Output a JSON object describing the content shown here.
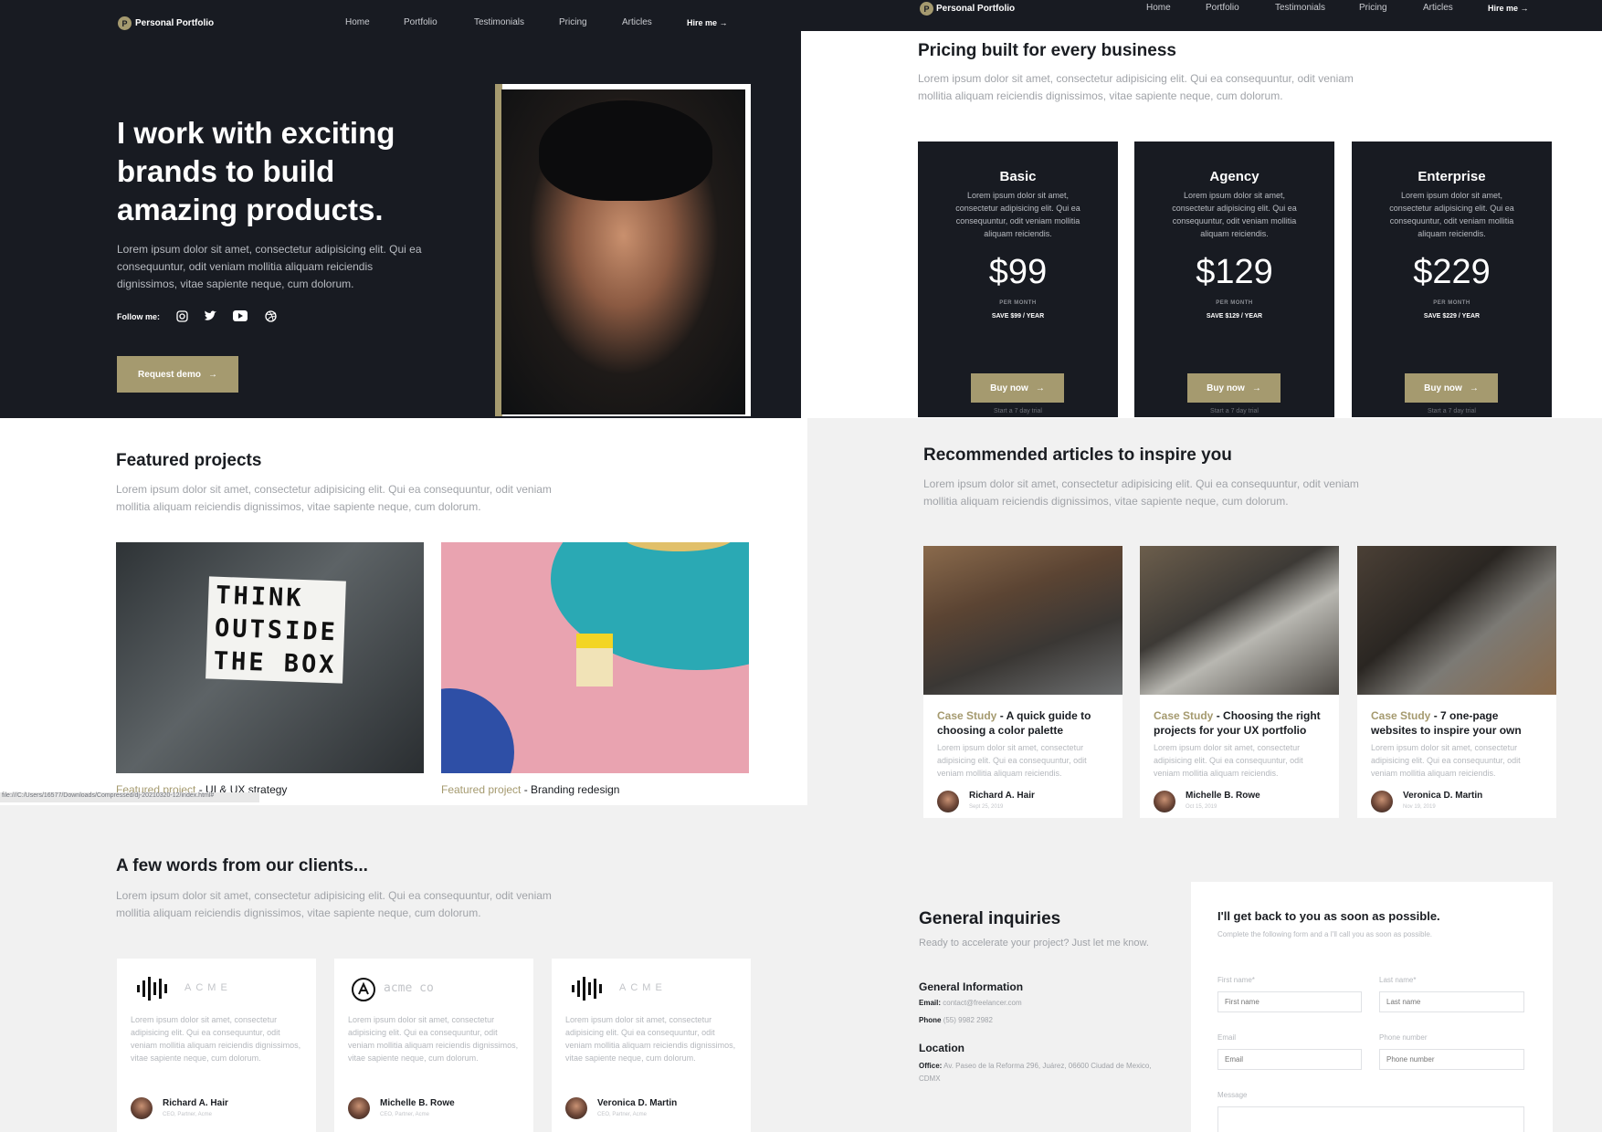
{
  "nav": {
    "logo_letter": "P",
    "brand": "Personal Portfolio",
    "links": [
      "Home",
      "Portfolio",
      "Testimonials",
      "Pricing",
      "Articles"
    ],
    "hire": "Hire me"
  },
  "hero": {
    "title": "I work with exciting brands to build amazing products.",
    "body": "Lorem ipsum dolor sit amet, consectetur adipisicing elit. Qui ea consequuntur, odit veniam mollitia aliquam reiciendis dignissimos, vitae sapiente neque, cum dolorum.",
    "follow_label": "Follow me:",
    "social": [
      "instagram-icon",
      "twitter-icon",
      "youtube-icon",
      "dribbble-icon"
    ],
    "cta": "Request demo"
  },
  "pricing": {
    "title": "Pricing built for every business",
    "subtitle": "Lorem ipsum dolor sit amet, consectetur adipisicing elit. Qui ea consequuntur, odit veniam mollitia aliquam reiciendis dignissimos, vitae sapiente neque, cum dolorum.",
    "plans": [
      {
        "name": "Basic",
        "desc": "Lorem ipsum dolor sit amet, consectetur adipisicing elit. Qui ea consequuntur, odit veniam mollitia aliquam reiciendis.",
        "price": "$99",
        "per": "PER MONTH",
        "save": "SAVE $99 / YEAR",
        "button": "Buy now",
        "trial": "Start a 7 day trial"
      },
      {
        "name": "Agency",
        "desc": "Lorem ipsum dolor sit amet, consectetur adipisicing elit. Qui ea consequuntur, odit veniam mollitia aliquam reiciendis.",
        "price": "$129",
        "per": "PER MONTH",
        "save": "SAVE $129 / YEAR",
        "button": "Buy now",
        "trial": "Start a 7 day trial"
      },
      {
        "name": "Enterprise",
        "desc": "Lorem ipsum dolor sit amet, consectetur adipisicing elit. Qui ea consequuntur, odit veniam mollitia aliquam reiciendis.",
        "price": "$229",
        "per": "PER MONTH",
        "save": "SAVE $229 / YEAR",
        "button": "Buy now",
        "trial": "Start a 7 day trial"
      }
    ]
  },
  "featured": {
    "title": "Featured projects",
    "subtitle": "Lorem ipsum dolor sit amet, consectetur adipisicing elit. Qui ea consequuntur, odit veniam mollitia aliquam reiciendis dignissimos, vitae sapiente neque, cum dolorum.",
    "lightbox_text": [
      "THINK",
      "OUTSIDE",
      "THE BOX"
    ],
    "projects": [
      {
        "tag": "Featured project",
        "name": " - UI & UX strategy"
      },
      {
        "tag": "Featured project",
        "name": " - Branding redesign"
      }
    ],
    "status_url": "file:///C:/Users/16577/Downloads/Compressed/dj-20210320-12/index.html#"
  },
  "articles": {
    "title": "Recommended articles to inspire you",
    "subtitle": "Lorem ipsum dolor sit amet, consectetur adipisicing elit. Qui ea consequuntur, odit veniam mollitia aliquam reiciendis dignissimos, vitae sapiente neque, cum dolorum.",
    "items": [
      {
        "tag": "Case Study",
        "title": " - A quick guide to choosing a color palette",
        "desc": "Lorem ipsum dolor sit amet, consectetur adipisicing elit. Qui ea consequuntur, odit veniam mollitia aliquam reiciendis.",
        "author": "Richard A. Hair",
        "date": "Sept 25, 2019"
      },
      {
        "tag": "Case Study",
        "title": " - Choosing the right projects for your UX portfolio",
        "desc": "Lorem ipsum dolor sit amet, consectetur adipisicing elit. Qui ea consequuntur, odit veniam mollitia aliquam reiciendis.",
        "author": "Michelle B. Rowe",
        "date": "Oct 15, 2019"
      },
      {
        "tag": "Case Study",
        "title": " - 7 one-page websites to inspire your own",
        "desc": "Lorem ipsum dolor sit amet, consectetur adipisicing elit. Qui ea consequuntur, odit veniam mollitia aliquam reiciendis.",
        "author": "Veronica D. Martin",
        "date": "Nov 19, 2019"
      }
    ]
  },
  "clients": {
    "title": "A few words from our clients...",
    "subtitle": "Lorem ipsum dolor sit amet, consectetur adipisicing elit. Qui ea consequuntur, odit veniam mollitia aliquam reiciendis dignissimos, vitae sapiente neque, cum dolorum.",
    "items": [
      {
        "logo": "ACME",
        "desc": "Lorem ipsum dolor sit amet, consectetur adipisicing elit. Qui ea consequuntur, odit veniam mollitia aliquam reiciendis dignissimos, vitae sapiente neque, cum dolorum.",
        "name": "Richard A. Hair",
        "role": "CEO, Partner, Acme"
      },
      {
        "logo": "acme co",
        "desc": "Lorem ipsum dolor sit amet, consectetur adipisicing elit. Qui ea consequuntur, odit veniam mollitia aliquam reiciendis dignissimos, vitae sapiente neque, cum dolorum.",
        "name": "Michelle B. Rowe",
        "role": "CEO, Partner, Acme"
      },
      {
        "logo": "ACME",
        "desc": "Lorem ipsum dolor sit amet, consectetur adipisicing elit. Qui ea consequuntur, odit veniam mollitia aliquam reiciendis dignissimos, vitae sapiente neque, cum dolorum.",
        "name": "Veronica D. Martin",
        "role": "CEO, Partner, Acme"
      }
    ]
  },
  "inquiries": {
    "title": "General inquiries",
    "subtitle": "Ready to accelerate your project? Just let me know.",
    "info_title": "General Information",
    "email_label": "Email:",
    "email": "contact@freelancer.com",
    "phone_label": "Phone",
    "phone": "(55) 9982 2982",
    "location_title": "Location",
    "office_label": "Office:",
    "office": "Av. Paseo de la Reforma 296, Juárez, 06600 Ciudad de Mexico, CDMX"
  },
  "form": {
    "title": "I'll get back to you as soon as possible.",
    "subtitle": "Complete the following form and a I'll call you as soon as possible.",
    "first_label": "First name*",
    "first_ph": "First name",
    "last_label": "Last name*",
    "last_ph": "Last name",
    "email_label": "Email",
    "email_ph": "Email",
    "phone_label": "Phone number",
    "phone_ph": "Phone number",
    "message_label": "Message"
  },
  "colors": {
    "dark": "#181b22",
    "gold": "#a59a6f"
  }
}
